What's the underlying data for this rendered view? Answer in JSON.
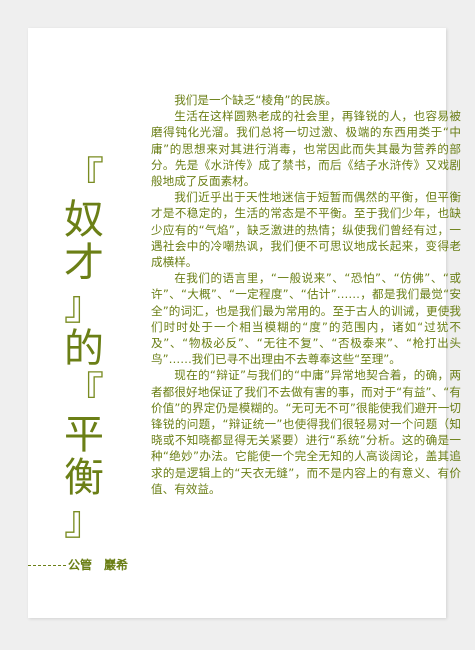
{
  "article": {
    "title_chars": [
      "『",
      "奴",
      "才",
      "』",
      "的",
      "『",
      "平",
      "衡",
      "』"
    ],
    "byline": {
      "prefix": "公管",
      "author": "巖希"
    },
    "paragraphs": [
      "我们是一个缺乏“棱角”的民族。",
      "生活在这样圆熟老成的社会里，再锋锐的人，也容易被磨得钝化光溜。我们总将一切过激、极端的东西用类于“中庸”的思想来对其进行消毒，也常因此而失其最为营养的部分。先是《水浒传》成了禁书，而后《结子水浒传》又戏剧般地成了反面素材。",
      "我们近乎出于天性地迷信于短暂而偶然的平衡，但平衡才是不稳定的，生活的常态是不平衡。至于我们少年，也缺少应有的“气焰”，缺乏激进的热情；纵使我们曾经有过，一遇社会中的冷嘲热讽，我们便不可思议地成长起来，变得老成横样。",
      "在我们的语言里，“一般说来”、“恐怕”、“仿佛”、“或许”、“大概”、“一定程度”、“估计”……，都是我们最觉“安全”的词汇，也是我们最为常用的。至于古人的训诫，更使我们时时处于一个相当模糊的“度”的范围内，诸如“过犹不及”、“物极必反”、“无往不复”、“否极泰来”、“枪打出头鸟”……我们已寻不出理由不去尊奉这些“至理”。",
      "现在的“辩证”与我们的“中庸”异常地契合着，的确，两者都很好地保证了我们不去做有害的事，而对于“有益”、“有价值”的界定仍是模糊的。“无可无不可”很能使我们避开一切锋锐的问题，“辩证统一”也使得我们很轻易对一个问题（知晓或不知晓都显得无关紧要）进行“系统”分析。这的确是一种“绝妙”办法。它能使一个完全无知的人高谈阔论，盖其追求的是逻辑上的“天衣无缝”，而不是内容上的有意义、有价值、有效益。"
    ]
  },
  "colors": {
    "text": "#6b7f16",
    "background": "#ffffff",
    "surround": "#efefef"
  }
}
